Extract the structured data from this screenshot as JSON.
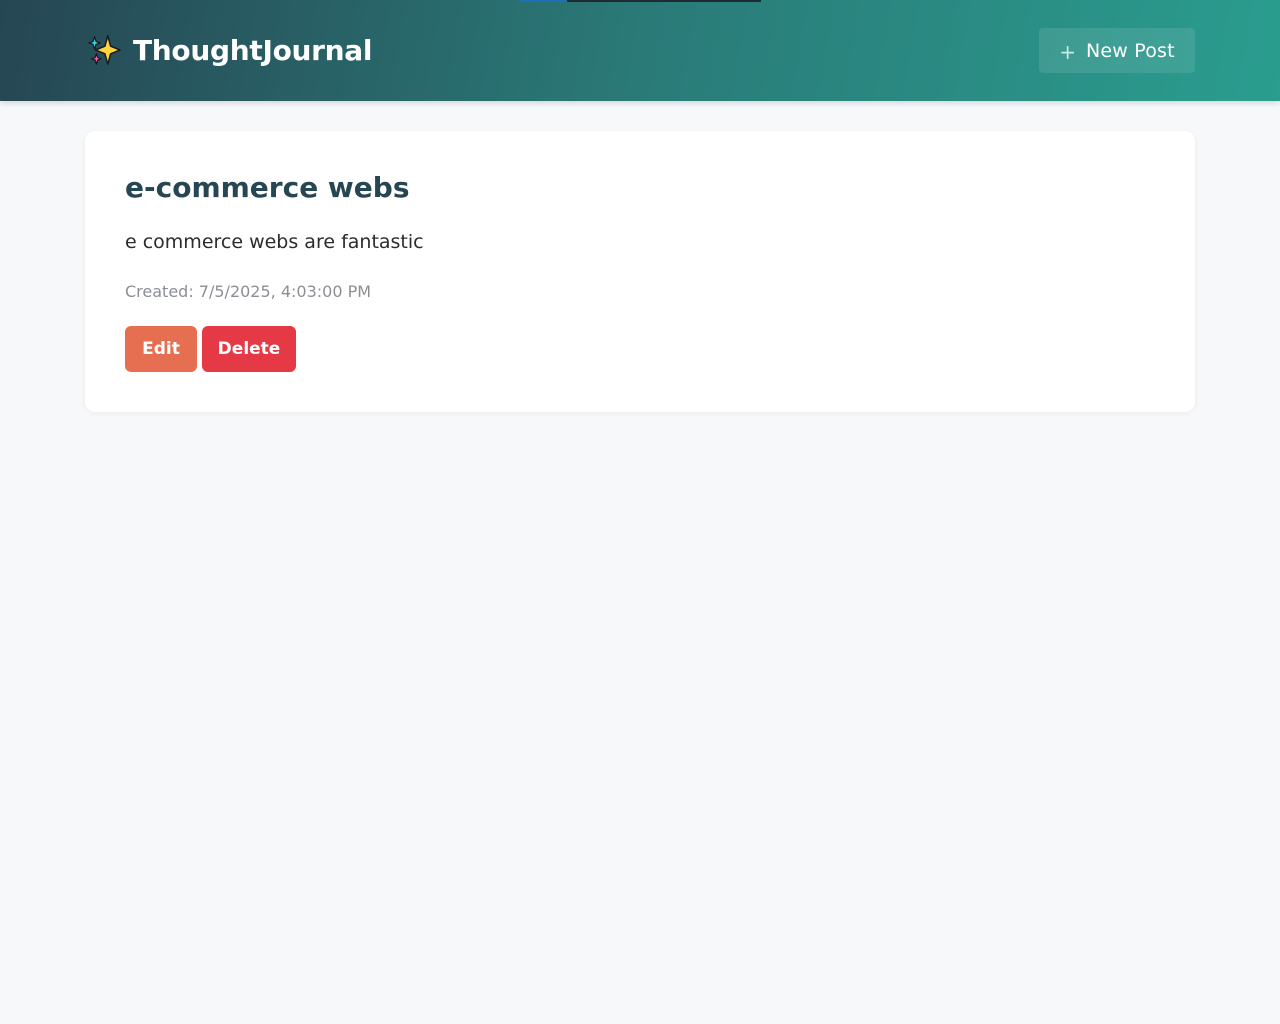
{
  "app": {
    "title": "ThoughtJournal",
    "logo_icon": "sparkles-icon"
  },
  "header": {
    "new_post_icon": "plus-icon",
    "new_post_symbol": "+",
    "new_post_label": "New Post",
    "loading_progress": 0.2
  },
  "posts": [
    {
      "title": "e-commerce webs",
      "content": "e commerce webs are fantastic",
      "created": "Created: 7/5/2025, 4:03:00 PM",
      "edit_label": "Edit",
      "delete_label": "Delete"
    }
  ],
  "colors": {
    "header_gradient_start": "#264653",
    "header_gradient_end": "#2a9d8f",
    "title": "#264653",
    "edit_button": "#e76f51",
    "delete_button": "#e63946",
    "background": "#f7f8fa",
    "meta_text": "#8b8f94"
  }
}
